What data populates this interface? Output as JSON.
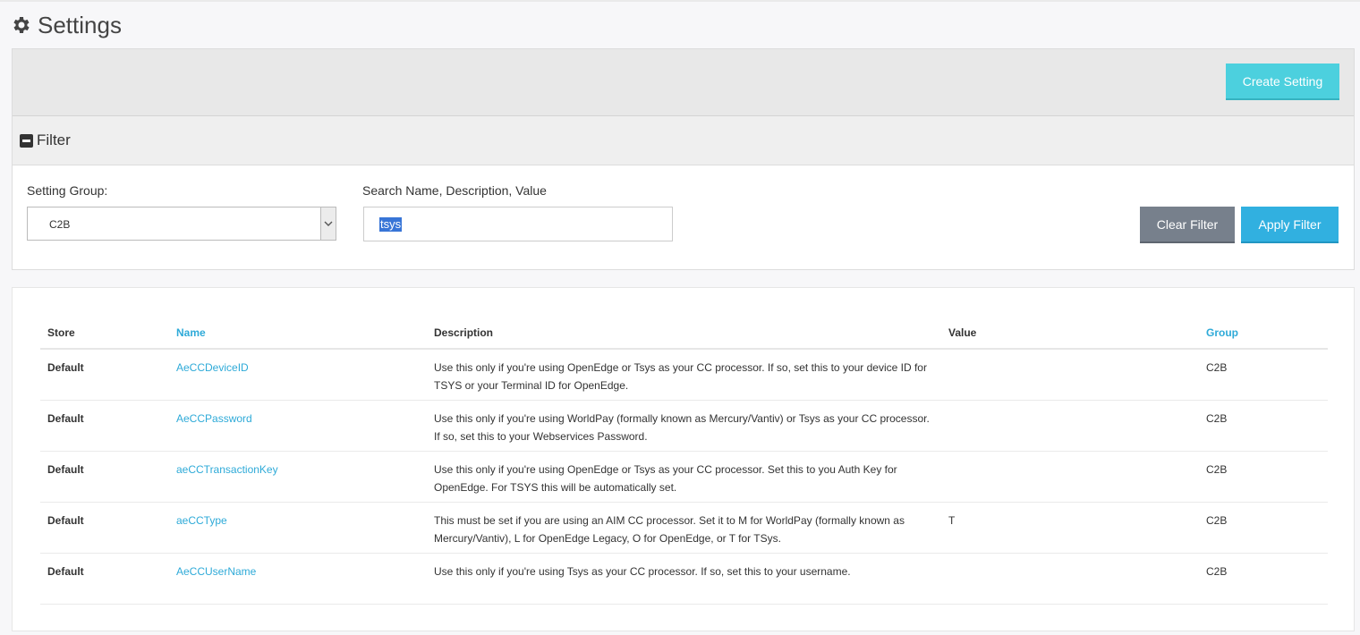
{
  "page": {
    "title": "Settings"
  },
  "toolbar": {
    "create_label": "Create Setting"
  },
  "filter": {
    "header": "Filter",
    "group_label": "Setting Group:",
    "group_value": "C2B",
    "search_label": "Search Name, Description, Value",
    "search_value": "tsys",
    "clear_label": "Clear Filter",
    "apply_label": "Apply Filter"
  },
  "table": {
    "columns": [
      "Store",
      "Name",
      "Description",
      "Value",
      "Group"
    ],
    "rows": [
      {
        "store": "Default",
        "name": "AeCCDeviceID",
        "description": "Use this only if you're using OpenEdge or Tsys as your CC processor. If so, set this to your device ID for TSYS or your Terminal ID for OpenEdge.",
        "value": "",
        "group": "C2B"
      },
      {
        "store": "Default",
        "name": "AeCCPassword",
        "description": "Use this only if you're using WorldPay (formally known as Mercury/Vantiv) or Tsys as your CC processor. If so, set this to your Webservices Password.",
        "value": "",
        "group": "C2B"
      },
      {
        "store": "Default",
        "name": "aeCCTransactionKey",
        "description": "Use this only if you're using OpenEdge or Tsys as your CC processor. Set this to you Auth Key for OpenEdge. For TSYS this will be automatically set.",
        "value": "",
        "group": "C2B"
      },
      {
        "store": "Default",
        "name": "aeCCType",
        "description": "This must be set if you are using an AIM CC processor. Set it to M for WorldPay (formally known as Mercury/Vantiv), L for OpenEdge Legacy, O for OpenEdge, or T for TSys.",
        "value": "T",
        "group": "C2B"
      },
      {
        "store": "Default",
        "name": "AeCCUserName",
        "description": "Use this only if you're using Tsys as your CC processor. If so, set this to your username.",
        "value": "",
        "group": "C2B"
      }
    ]
  },
  "colors": {
    "accent_link": "#2eaad8",
    "create_button": "#4cd0de",
    "apply_button": "#31b0e0",
    "clear_button": "#77808c"
  },
  "icons": {
    "title": "gear-icon",
    "filter": "minus-square-icon",
    "select": "chevron-down-icon"
  }
}
